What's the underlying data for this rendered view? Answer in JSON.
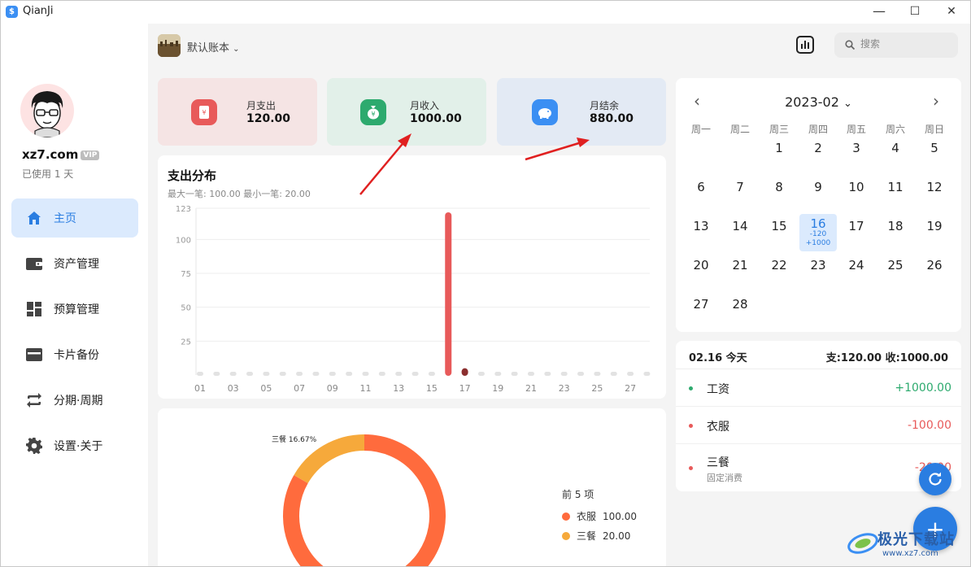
{
  "app": {
    "title": "QianJi"
  },
  "window": {
    "minimize": "—",
    "maximize": "☐",
    "close": "✕"
  },
  "user": {
    "name": "xz7.com",
    "vip": "VIP",
    "usage": "已使用 1 天"
  },
  "nav": [
    {
      "label": "主页",
      "icon": "home-icon",
      "active": true
    },
    {
      "label": "资产管理",
      "icon": "wallet-icon"
    },
    {
      "label": "预算管理",
      "icon": "dashboard-icon"
    },
    {
      "label": "卡片备份",
      "icon": "card-icon"
    },
    {
      "label": "分期·周期",
      "icon": "repeat-icon"
    },
    {
      "label": "设置·关于",
      "icon": "gear-icon"
    }
  ],
  "topbar": {
    "account": "默认账本",
    "search_placeholder": "搜索"
  },
  "summary": {
    "expense": {
      "label": "月支出",
      "value": "120.00",
      "color": "#e85a5a",
      "bg": "#f5e4e4"
    },
    "income": {
      "label": "月收入",
      "value": "1000.00",
      "color": "#2daa6e",
      "bg": "#e2f0e9"
    },
    "balance": {
      "label": "月结余",
      "value": "880.00",
      "color": "#3b8ff3",
      "bg": "#e3eaf4"
    }
  },
  "expense_chart": {
    "title": "支出分布",
    "subtitle": "最大一笔: 100.00 最小一笔: 20.00"
  },
  "pie_legend": {
    "title": "前 5 项"
  },
  "chart_data": [
    {
      "type": "bar",
      "categories": [
        "01",
        "02",
        "03",
        "04",
        "05",
        "06",
        "07",
        "08",
        "09",
        "10",
        "11",
        "12",
        "13",
        "14",
        "15",
        "16",
        "17",
        "18",
        "19",
        "20",
        "21",
        "22",
        "23",
        "24",
        "25",
        "26",
        "27",
        "28"
      ],
      "xtick_labels": [
        "01",
        "03",
        "05",
        "07",
        "09",
        "11",
        "13",
        "15",
        "17",
        "19",
        "21",
        "23",
        "25",
        "27"
      ],
      "ytick_labels": [
        "123",
        "100",
        "75",
        "50",
        "25"
      ],
      "values": [
        0,
        0,
        0,
        0,
        0,
        0,
        0,
        0,
        0,
        0,
        0,
        0,
        0,
        0,
        0,
        120,
        5,
        0,
        0,
        0,
        0,
        0,
        0,
        0,
        0,
        0,
        0,
        0
      ],
      "ylim": [
        0,
        123
      ],
      "grid": true,
      "highlight_color": "#e85a5a",
      "secondary_color": "#8b2e2e"
    },
    {
      "type": "pie",
      "labels": [
        "衣服",
        "三餐"
      ],
      "values": [
        100.0,
        20.0
      ],
      "value_labels": [
        "100.00",
        "20.00"
      ],
      "colors": [
        "#ff6b3d",
        "#f6a93b"
      ],
      "annotation": "三餐 16.67%"
    }
  ],
  "calendar": {
    "month": "2023-02",
    "weekdays": [
      "周一",
      "周二",
      "周三",
      "周四",
      "周五",
      "周六",
      "周日"
    ],
    "days": [
      "1",
      "2",
      "3",
      "4",
      "5",
      "6",
      "7",
      "8",
      "9",
      "10",
      "11",
      "12",
      "13",
      "14",
      "15",
      "16",
      "17",
      "18",
      "19",
      "20",
      "21",
      "22",
      "23",
      "24",
      "25",
      "26",
      "27",
      "28"
    ],
    "first_weekday_index": 2,
    "today": {
      "day": "16",
      "expense": "-120",
      "income": "+1000"
    }
  },
  "transactions": {
    "date_label": "02.16 今天",
    "summary": "支:120.00 收:1000.00",
    "items": [
      {
        "name": "工资",
        "amount": "+1000.00",
        "color": "#2daa6e"
      },
      {
        "name": "衣服",
        "amount": "-100.00",
        "color": "#e85a5a"
      },
      {
        "name": "三餐",
        "sub": "固定消费",
        "amount": "-20.00",
        "color": "#e85a5a"
      }
    ]
  },
  "watermark": "极光下载站 www.xz7.com"
}
